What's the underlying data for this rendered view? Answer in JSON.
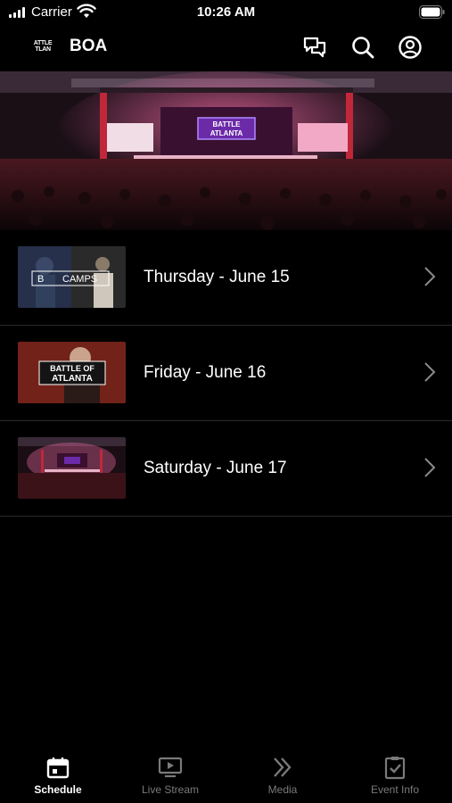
{
  "status_bar": {
    "carrier": "Carrier",
    "time": "10:26 AM"
  },
  "header": {
    "logo_text": "BATTLE ATLANTA",
    "logo_line1": "ATTLE",
    "logo_line2": "TLAN",
    "title": "BOA"
  },
  "schedule": {
    "days": [
      {
        "label": "Thursday - June 15",
        "thumb_caption": "BOSS CAMPS",
        "thumb_caption_a": "B",
        "thumb_caption_b": "CAMPS"
      },
      {
        "label": "Friday - June 16",
        "thumb_caption_line1": "BATTLE OF",
        "thumb_caption_line2": "ATLANTA"
      },
      {
        "label": "Saturday - June 17"
      }
    ]
  },
  "tabbar": {
    "tabs": [
      {
        "label": "Schedule",
        "icon": "calendar-icon",
        "active": true
      },
      {
        "label": "Live Stream",
        "icon": "tv-play-icon",
        "active": false
      },
      {
        "label": "Media",
        "icon": "double-chevron-icon",
        "active": false
      },
      {
        "label": "Event Info",
        "icon": "clipboard-check-icon",
        "active": false
      }
    ]
  },
  "colors": {
    "background": "#000000",
    "accent_red": "#c0283a",
    "inactive_tab": "#7a7a7a",
    "divider": "#2a2a2a"
  }
}
